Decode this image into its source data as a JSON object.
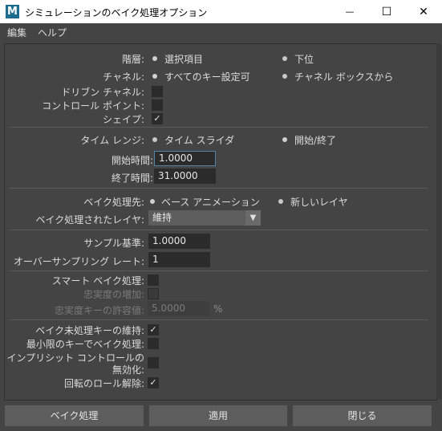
{
  "window": {
    "app_icon_letter": "M",
    "title": "シミュレーションのベイク処理オプション",
    "minimize_glyph": "—",
    "maximize_glyph": "☐",
    "close_glyph": "✕"
  },
  "menubar": {
    "edit": "編集",
    "help": "ヘルプ"
  },
  "hierarchy": {
    "label": "階層:",
    "opt_selected": "選択項目",
    "opt_below": "下位"
  },
  "channels": {
    "label": "チャネル:",
    "opt_all_keyable": "すべてのキー設定可",
    "opt_channel_box": "チャネル ボックスから"
  },
  "driven_channels": {
    "label": "ドリブン チャネル:"
  },
  "control_points": {
    "label": "コントロール ポイント:"
  },
  "shapes": {
    "label": "シェイプ:",
    "check": "✓"
  },
  "time_range": {
    "label": "タイム レンジ:",
    "opt_time_slider": "タイム スライダ",
    "opt_start_end": "開始/終了"
  },
  "start_time": {
    "label": "開始時間:",
    "value": "1.0000"
  },
  "end_time": {
    "label": "終了時間:",
    "value": "31.0000"
  },
  "bake_to": {
    "label": "ベイク処理先:",
    "opt_base": "ベース アニメーション",
    "opt_new_layer": "新しいレイヤ"
  },
  "baked_layers": {
    "label": "ベイク処理されたレイヤ:",
    "value": "維持",
    "arrow": "▼"
  },
  "sample_by": {
    "label": "サンプル基準:",
    "value": "1.0000"
  },
  "oversampling": {
    "label": "オーバーサンプリング レート:",
    "value": "1"
  },
  "smart_bake": {
    "label": "スマート ベイク処理:"
  },
  "increase_fidelity": {
    "label": "忠実度の増加:"
  },
  "fidelity_tolerance": {
    "label": "忠実度キーの許容値:",
    "value": "5.0000",
    "unit": "%"
  },
  "keep_unbaked": {
    "label": "ベイク未処理キーの維持:",
    "check": "✓"
  },
  "sparse_curve": {
    "label": "最小限のキーでベイク処理:"
  },
  "disable_implicit": {
    "label_line1": "インプリシット コントロールの",
    "label_line2": "無効化:"
  },
  "unroll_rotation": {
    "label": "回転のロール解除:",
    "check": "✓"
  },
  "buttons": {
    "bake": "ベイク処理",
    "apply": "適用",
    "close": "閉じる"
  }
}
